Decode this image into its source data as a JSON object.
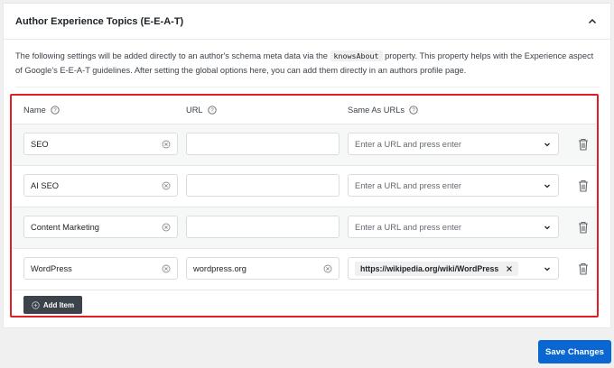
{
  "panel": {
    "title": "Author Experience Topics (E-E-A-T)",
    "description_before": "The following settings will be added directly to an author's schema meta data via the ",
    "description_code": "knowsAbout",
    "description_after": " property. This property helps with the Experience aspect of Google's E-E-A-T guidelines. After setting the global options here, you can add them directly in an authors profile page."
  },
  "columns": {
    "name": "Name",
    "url": "URL",
    "same_as": "Same As URLs"
  },
  "rows": [
    {
      "name": "SEO",
      "url": "",
      "same_as_placeholder": "Enter a URL and press enter"
    },
    {
      "name": "AI SEO",
      "url": "",
      "same_as_placeholder": "Enter a URL and press enter"
    },
    {
      "name": "Content Marketing",
      "url": "",
      "same_as_placeholder": "Enter a URL and press enter"
    },
    {
      "name": "WordPress",
      "url": "wordpress.org",
      "same_as_tag": "https://wikipedia.org/wiki/WordPress"
    }
  ],
  "add_item_label": "Add Item",
  "save_label": "Save Changes",
  "colors": {
    "highlight": "#e01e23",
    "primary": "#0a66d1",
    "dark_button": "#3c434a"
  }
}
